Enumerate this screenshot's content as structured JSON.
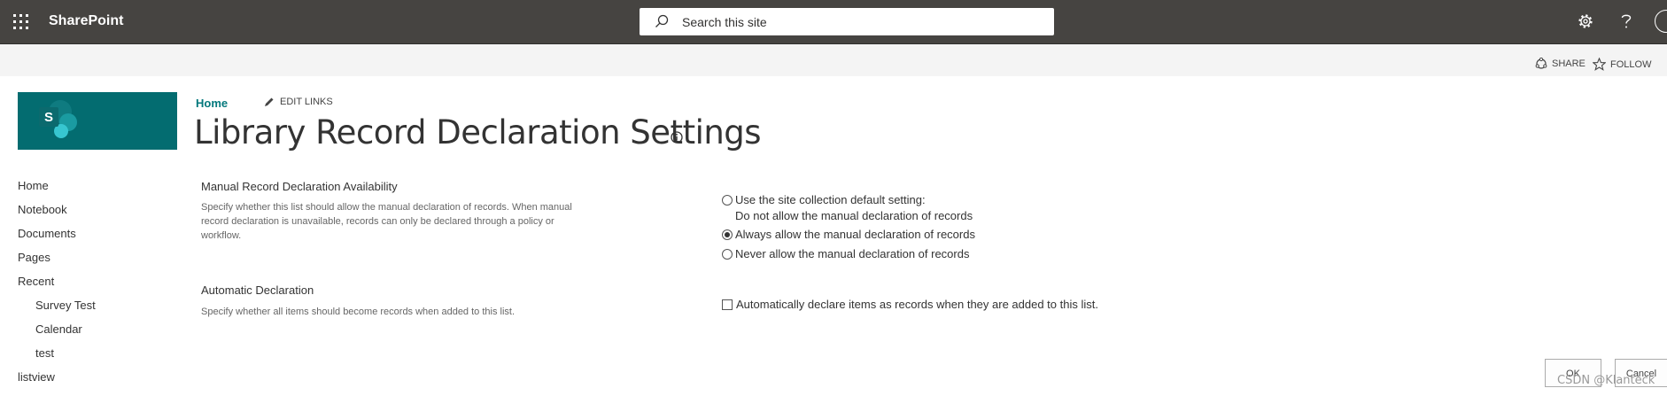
{
  "suite_bar": {
    "app_name": "SharePoint",
    "search_placeholder": "Search this site",
    "icons": [
      "waffle-icon",
      "gear-icon",
      "help-icon",
      "avatar"
    ]
  },
  "action_bar": {
    "share_label": "SHARE",
    "follow_label": "FOLLOW"
  },
  "site": {
    "logo_letter": "S",
    "logo_color": "#036c70"
  },
  "left_nav": [
    {
      "label": "Home",
      "indent": false
    },
    {
      "label": "Notebook",
      "indent": false
    },
    {
      "label": "Documents",
      "indent": false
    },
    {
      "label": "Pages",
      "indent": false
    },
    {
      "label": "Recent",
      "indent": false
    },
    {
      "label": "Survey Test",
      "indent": true
    },
    {
      "label": "Calendar",
      "indent": true
    },
    {
      "label": "test",
      "indent": true
    },
    {
      "label": "listview",
      "indent": false
    }
  ],
  "header": {
    "breadcrumb_home": "Home",
    "edit_links_label": "EDIT LINKS",
    "page_title": "Library Record Declaration Settings"
  },
  "sections": {
    "manual": {
      "title": "Manual Record Declaration Availability",
      "description_lines": [
        "Specify whether this list should allow the manual declaration of records.  When manual",
        "record declaration is unavailable, records can only be declared through a policy or",
        "workflow."
      ],
      "options": [
        {
          "label": "Use the site collection default setting:",
          "sublabel": "Do not allow the manual declaration of records",
          "checked": false
        },
        {
          "label": "Always allow the manual declaration of records",
          "checked": true
        },
        {
          "label": "Never allow the manual declaration of records",
          "checked": false
        }
      ]
    },
    "automatic": {
      "title": "Automatic Declaration",
      "description": "Specify whether all items should become records when added to this list.",
      "checkbox_label": "Automatically declare items as records when they are added to this list.",
      "checked": false
    }
  },
  "buttons": {
    "ok_label": "OK",
    "cancel_label": "Cancel"
  },
  "watermark": "CSDN @Klanteck",
  "colors": {
    "suite_bar": "#464441",
    "accent": "#03787c",
    "action_bar": "#f4f4f4"
  }
}
